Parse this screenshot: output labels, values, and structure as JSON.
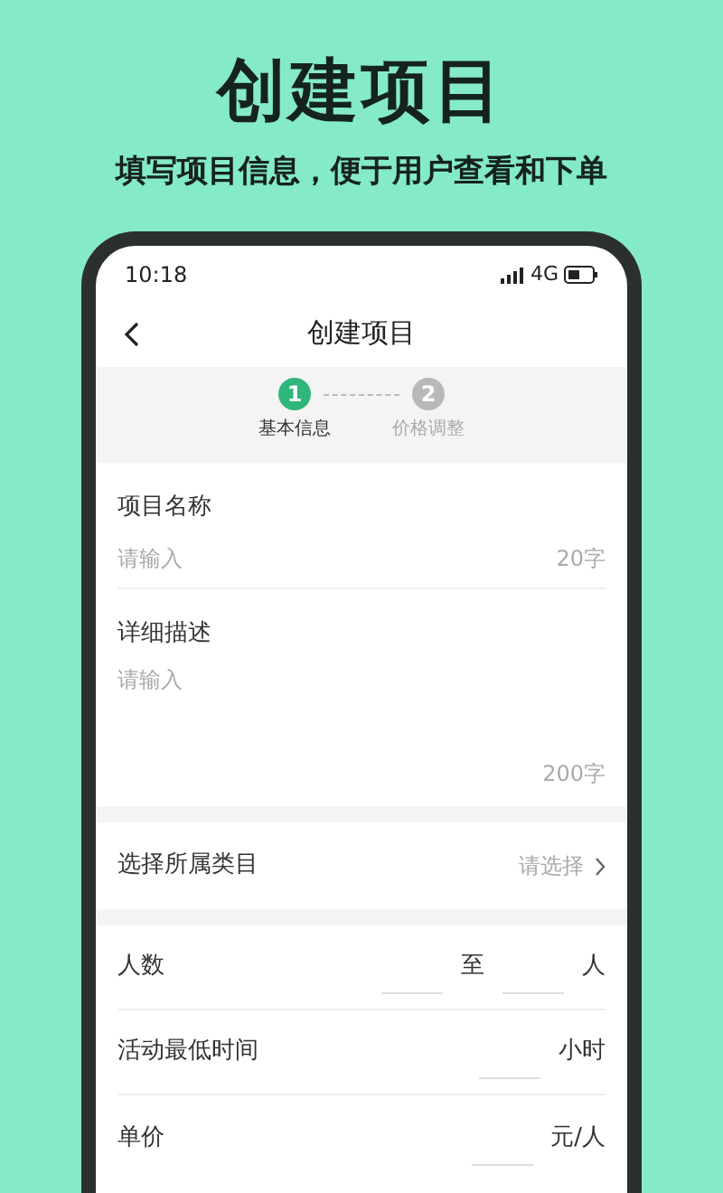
{
  "headline": "创建项目",
  "subheadline": "填写项目信息，便于用户查看和下单",
  "phone": {
    "status_bar": {
      "time": "10:18",
      "network": "4G"
    },
    "nav": {
      "title": "创建项目"
    },
    "steps": [
      {
        "number": "1",
        "label": "基本信息",
        "selected": true
      },
      {
        "number": "2",
        "label": "价格调整",
        "selected": false
      }
    ],
    "groups": [
      {
        "items": [
          {
            "kind": "text_input",
            "label": "项目名称",
            "placeholder": "请输入",
            "counter": "20字"
          },
          {
            "kind": "textarea",
            "label": "详细描述",
            "placeholder": "请输入",
            "counter": "200字"
          }
        ]
      },
      {
        "items": [
          {
            "kind": "select",
            "label": "选择所属类目",
            "placeholder": "请选择"
          }
        ]
      },
      {
        "items": [
          {
            "kind": "range",
            "label": "人数",
            "separator": "至",
            "unit": "人"
          },
          {
            "kind": "unit",
            "label": "活动最低时间",
            "unit": "小时"
          },
          {
            "kind": "unit",
            "label": "单价",
            "unit": "元/人"
          }
        ]
      }
    ]
  }
}
